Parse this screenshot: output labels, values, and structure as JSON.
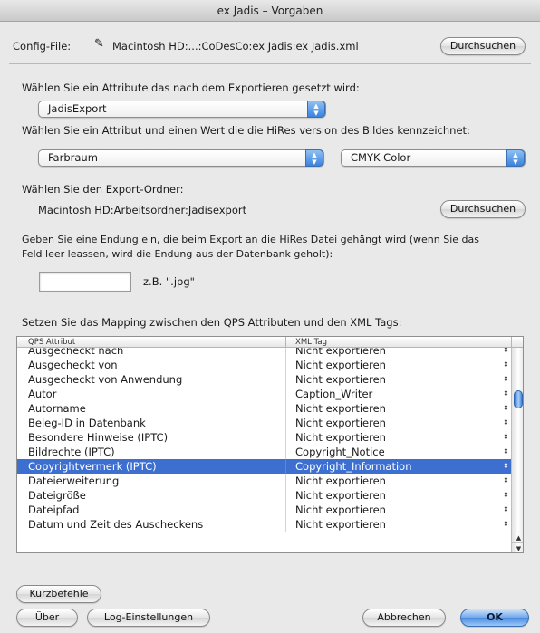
{
  "window": {
    "title": "ex Jadis – Vorgaben"
  },
  "config": {
    "label": "Config-File:",
    "pencil_icon": "pencil-icon",
    "path": "Macintosh HD:...:CoDesCo:ex Jadis:ex Jadis.xml",
    "browse_label": "Durchsuchen"
  },
  "attribute": {
    "label": "Wählen Sie ein Attribute das nach dem Exportieren gesetzt wird:",
    "selected": "JadisExport"
  },
  "hires": {
    "label": "Wählen Sie ein Attribut und einen Wert die die HiRes version des Bildes kennzeichnet:",
    "attribute_selected": "Farbraum",
    "value_selected": "CMYK Color"
  },
  "export_folder": {
    "label": "Wählen Sie den Export-Ordner:",
    "path": "Macintosh HD:Arbeitsordner:Jadisexport",
    "browse_label": "Durchsuchen"
  },
  "extension": {
    "label_line1": "Geben Sie eine Endung ein, die beim Export an die HiRes Datei gehängt wird (wenn Sie das",
    "label_line2": "Feld leer leassen, wird die Endung aus der Datenbank geholt):",
    "value": "",
    "example": "z.B. \".jpg\""
  },
  "mapping": {
    "label": "Setzen Sie das Mapping zwischen den QPS Attributen und den XML Tags:",
    "columns": [
      "QPS Attribut",
      "XML Tag"
    ],
    "stepper_glyph": "⇕",
    "rows": [
      {
        "qps": "Ausgecheckt nach",
        "xml": "Nicht exportieren"
      },
      {
        "qps": "Ausgecheckt von",
        "xml": "Nicht exportieren"
      },
      {
        "qps": "Ausgecheckt von Anwendung",
        "xml": "Nicht exportieren"
      },
      {
        "qps": "Autor",
        "xml": "Caption_Writer"
      },
      {
        "qps": "Autorname",
        "xml": "Nicht exportieren"
      },
      {
        "qps": "Beleg-ID in Datenbank",
        "xml": "Nicht exportieren"
      },
      {
        "qps": "Besondere Hinweise (IPTC)",
        "xml": "Nicht exportieren"
      },
      {
        "qps": "Bildrechte (IPTC)",
        "xml": "Copyright_Notice"
      },
      {
        "qps": "Copyrightvermerk (IPTC)",
        "xml": "Copyright_Information",
        "selected": true
      },
      {
        "qps": "Dateierweiterung",
        "xml": "Nicht exportieren"
      },
      {
        "qps": "Dateigröße",
        "xml": "Nicht exportieren"
      },
      {
        "qps": "Dateipfad",
        "xml": "Nicht exportieren"
      },
      {
        "qps": "Datum und Zeit des Auscheckens",
        "xml": "Nicht exportieren"
      }
    ]
  },
  "buttons": {
    "shortcuts": "Kurzbefehle",
    "about": "Über",
    "log_settings": "Log-Einstellungen",
    "cancel": "Abbrechen",
    "ok": "OK"
  },
  "colors": {
    "selection": "#3d6fd1",
    "default_button": "#4a8be0"
  }
}
